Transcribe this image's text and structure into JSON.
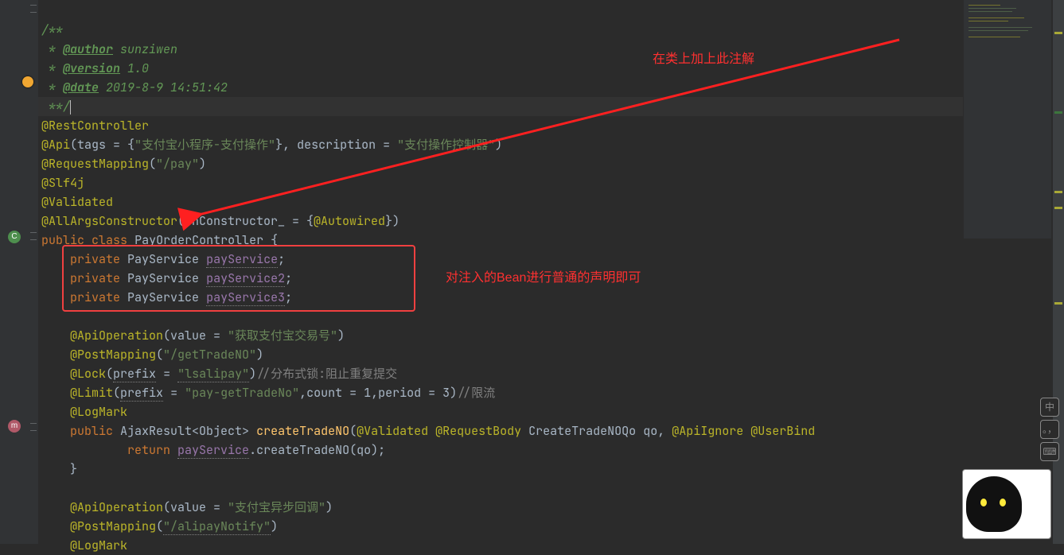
{
  "annotations": {
    "top_note": "在类上加上此注解",
    "box_note": "对注入的Bean进行普通的声明即可"
  },
  "ime": {
    "lang": "中",
    "punct": "。，",
    "shape": "⌨"
  },
  "gutter_icons": {
    "c": "C",
    "m": "m"
  },
  "code": {
    "doc_open": "/**",
    "doc_author_tag": "@author",
    "doc_author_val": " sunziwen",
    "doc_version_tag": "@version",
    "doc_version_val": " 1.0",
    "doc_date_tag": "@date",
    "doc_date_val": " 2019-8-9 14:51:42",
    "doc_close": "**/",
    "anno_rest": "@RestController",
    "anno_api": "@Api",
    "api_tags_lbl": "tags = {",
    "api_tags_val": "\"支付宝小程序-支付操作\"",
    "api_desc_lbl": "}, description = ",
    "api_desc_val": "\"支付操作控制器\"",
    "anno_reqmap": "@RequestMapping",
    "reqmap_val": "\"/pay\"",
    "anno_slf4j": "@Slf4j",
    "anno_valid": "@Validated",
    "anno_allargs": "@AllArgsConstructor",
    "allargs_param": "onConstructor_ = {",
    "anno_autowired": "@Autowired",
    "kw_public": "public",
    "kw_class": "class",
    "cls_name": "PayOrderController",
    "kw_private": "private",
    "type_payservice": "PayService",
    "f1": "payService",
    "f2": "payService2",
    "f3": "payService3",
    "anno_apiop": "@ApiOperation",
    "apiop_val1": "\"获取支付宝交易号\"",
    "anno_postmap": "@PostMapping",
    "postmap_val1": "\"/getTradeNO\"",
    "anno_lock": "@Lock",
    "lock_prefix_lbl": "prefix",
    "lock_prefix_val": "\"lsalipay\"",
    "lock_comment": "//分布式锁:阻止重复提交",
    "anno_limit": "@Limit",
    "limit_prefix_val": "\"pay-getTradeNo\"",
    "limit_count": "count = ",
    "limit_count_v": "1",
    "limit_period": "period = ",
    "limit_period_v": "3",
    "limit_comment": "//限流",
    "anno_logmark": "@LogMark",
    "ret_type": "AjaxResult<Object>",
    "fn_create": "createTradeNO",
    "p_valid": "@Validated",
    "p_reqbody": "@RequestBody",
    "p_type1": "CreateTradeNOQo",
    "p_name1": "qo",
    "p_apiignore": "@ApiIgnore",
    "p_userbind": "@UserBind",
    "kw_return": "return",
    "call_field": "payService",
    "call_method": "createTradeNO",
    "apiop_val2": "\"支付宝异步回调\"",
    "postmap_val2": "\"/alipayNotify\""
  }
}
